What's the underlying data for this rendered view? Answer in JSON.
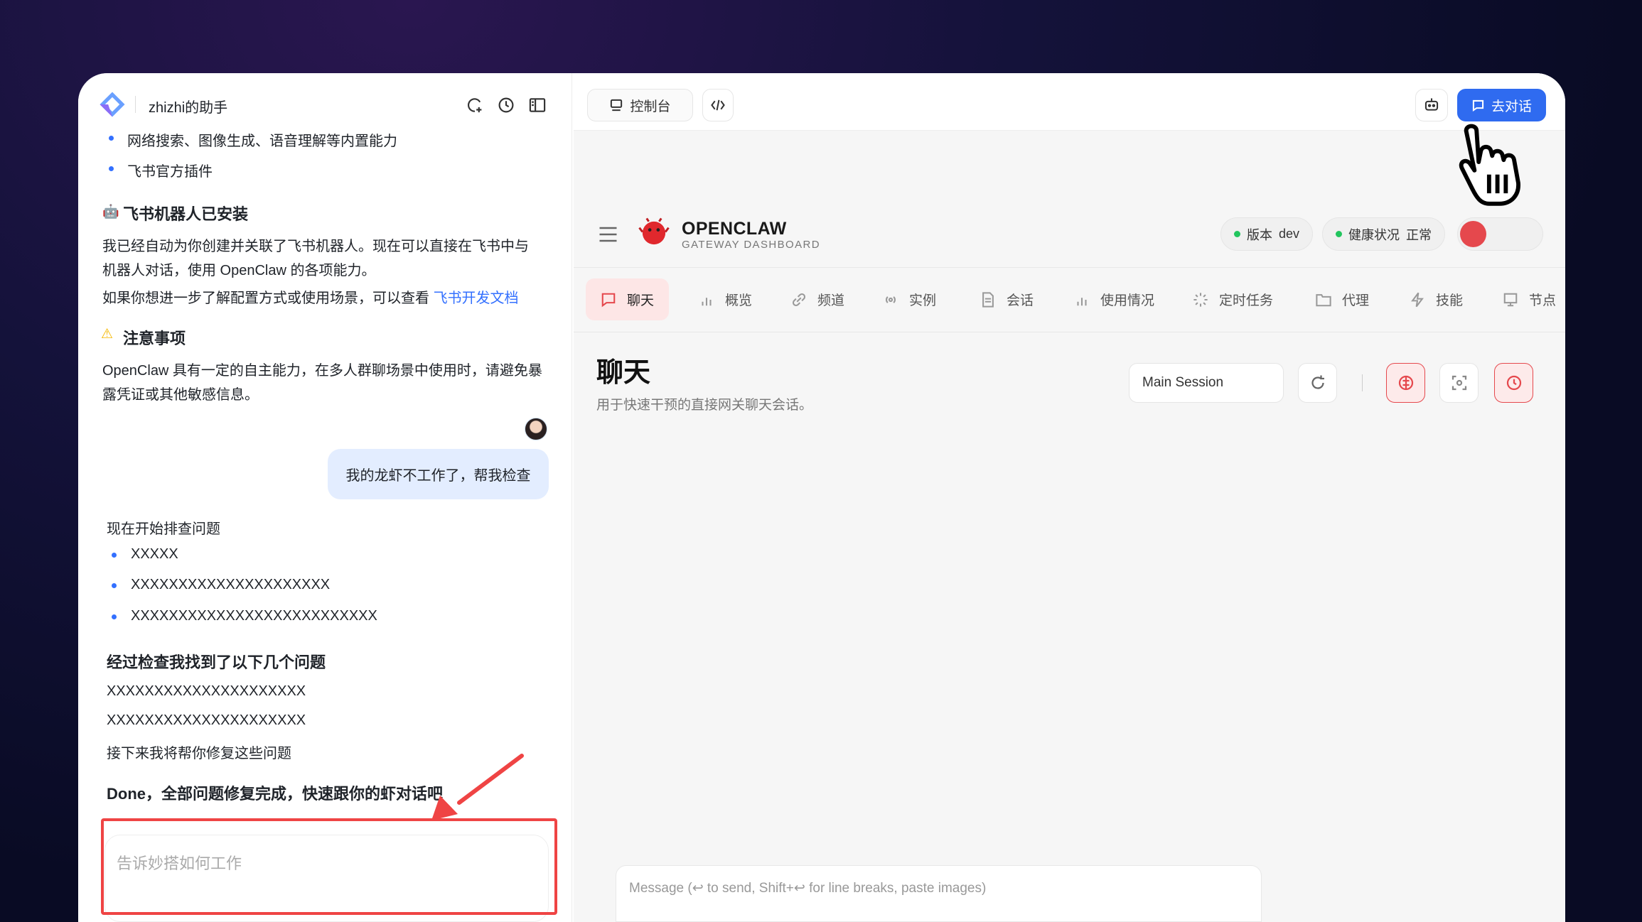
{
  "assistant": {
    "title": "zhizhi的助手",
    "bullets_top": [
      "网络搜索、图像生成、语音理解等内置能力",
      "飞书官方插件"
    ],
    "bot_section": {
      "heading": "飞书机器人已安装",
      "body": "我已经自动为你创建并关联了飞书机器人。现在可以直接在飞书中与机器人对话，使用 OpenClaw 的各项能力。",
      "more_prefix": "如果你想进一步了解配置方式或使用场景，可以查看",
      "doc_link": "飞书开发文档"
    },
    "notice": {
      "heading": "注意事项",
      "body": "OpenClaw 具有一定的自主能力，在多人群聊场景中使用时，请避免暴露凭证或其他敏感信息。"
    },
    "user_message": "我的龙虾不工作了，帮我检查",
    "reply": {
      "intro": "现在开始排查问题",
      "bullets": [
        "XXXXX",
        "XXXXXXXXXXXXXXXXXXXXX",
        "XXXXXXXXXXXXXXXXXXXXXXXXXX"
      ],
      "found_heading": "经过检查我找到了以下几个问题",
      "found_lines": [
        "XXXXXXXXXXXXXXXXXXXXX",
        "XXXXXXXXXXXXXXXXXXXXX"
      ],
      "next": "接下来我将帮你修复这些问题",
      "done": "Done，全部问题修复完成，快速跟你的虾对话吧"
    },
    "input_placeholder": "告诉妙搭如何工作"
  },
  "topbar": {
    "console_label": "控制台",
    "go_chat_label": "去对话"
  },
  "dashboard": {
    "brand": "OPENCLAW",
    "subtitle": "GATEWAY DASHBOARD",
    "version_label": "版本",
    "version_value": "dev",
    "health_label": "健康状况",
    "health_value": "正常",
    "tabs": [
      "聊天",
      "概览",
      "频道",
      "实例",
      "会话",
      "使用情况",
      "定时任务",
      "代理",
      "技能",
      "节点"
    ],
    "page_title": "聊天",
    "page_desc": "用于快速干预的直接网关聊天会话。",
    "session_value": "Main Session",
    "message_placeholder": "Message (↩ to send, Shift+↩ for line breaks, paste images)"
  },
  "colors": {
    "accent_blue": "#2f6bf0",
    "accent_red": "#e5484d",
    "annotation_red": "#ef4444"
  }
}
